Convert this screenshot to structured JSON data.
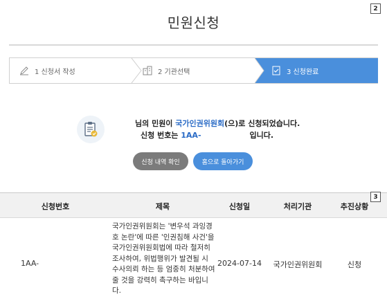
{
  "page": {
    "title": "민원신청"
  },
  "markers": {
    "tag2": "2",
    "tag3": "3"
  },
  "steps": [
    {
      "label": "1 신청서 작성",
      "icon": "pencil-icon",
      "active": false
    },
    {
      "label": "2 기관선택",
      "icon": "building-icon",
      "active": false
    },
    {
      "label": "3 신청완료",
      "icon": "document-check-icon",
      "active": true
    }
  ],
  "notice": {
    "prefix": "님의 민원이 ",
    "agency": "국가인권위원회",
    "suffix": "(으)로 신청되었습니다.",
    "number_label": "신청 번호는 ",
    "number_value": "1AA-",
    "number_suffix": "입니다."
  },
  "buttons": {
    "history": "신청 내역 확인",
    "home": "홈으로 돌아가기"
  },
  "table": {
    "headers": [
      "신청번호",
      "제목",
      "신청일",
      "처리기관",
      "추진상황"
    ],
    "rows": [
      {
        "number": "1AA-",
        "title": "국가인권위원회는 '변우석 과잉경호 논란'에 따른 '인권침해 사건'을 국가인권위원회법에 따라 철저히 조사하여, 위법행위가 발견될 시 수사의뢰 하는 등 엄중히 처분하여 줄 것을 강력히 촉구하는 바입니다.",
        "date": "2024-07-14",
        "agency": "국가인권위원회",
        "status": "신청"
      }
    ]
  },
  "colors": {
    "accent": "#4a8fdc",
    "link": "#2a6bc6",
    "secondary_button": "#7b7b7b"
  }
}
